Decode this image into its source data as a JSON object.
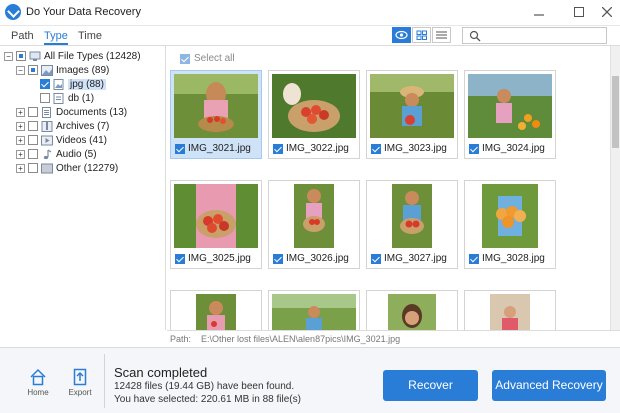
{
  "window": {
    "title": "Do Your Data Recovery"
  },
  "tabs": [
    {
      "label": "Path"
    },
    {
      "label": "Type"
    },
    {
      "label": "Time"
    }
  ],
  "search": {
    "placeholder": ""
  },
  "tree": [
    {
      "label": "All File Types (12428)"
    },
    {
      "label": "Images (89)"
    },
    {
      "label": "jpg (88)"
    },
    {
      "label": "db (1)"
    },
    {
      "label": "Documents (13)"
    },
    {
      "label": "Archives (7)"
    },
    {
      "label": "Videos (41)"
    },
    {
      "label": "Audio (5)"
    },
    {
      "label": "Other (12279)"
    }
  ],
  "grid": {
    "select_all": "Select all",
    "items": [
      {
        "name": "IMG_3021.jpg"
      },
      {
        "name": "IMG_3022.jpg"
      },
      {
        "name": "IMG_3023.jpg"
      },
      {
        "name": "IMG_3024.jpg"
      },
      {
        "name": "IMG_3025.jpg"
      },
      {
        "name": "IMG_3026.jpg"
      },
      {
        "name": "IMG_3027.jpg"
      },
      {
        "name": "IMG_3028.jpg"
      }
    ]
  },
  "pathbar": {
    "label": "Path:",
    "value": "E:\\Other lost files\\ALEN\\alen87pics\\IMG_3021.jpg"
  },
  "footer": {
    "home": "Home",
    "export": "Export",
    "title": "Scan completed",
    "line1": "12428 files (19.44 GB) have been found.",
    "line2": "You have selected: 220.61 MB in 88 file(s)",
    "recover": "Recover",
    "advanced": "Advanced Recovery"
  },
  "colors": {
    "accent": "#2a7dd6"
  }
}
